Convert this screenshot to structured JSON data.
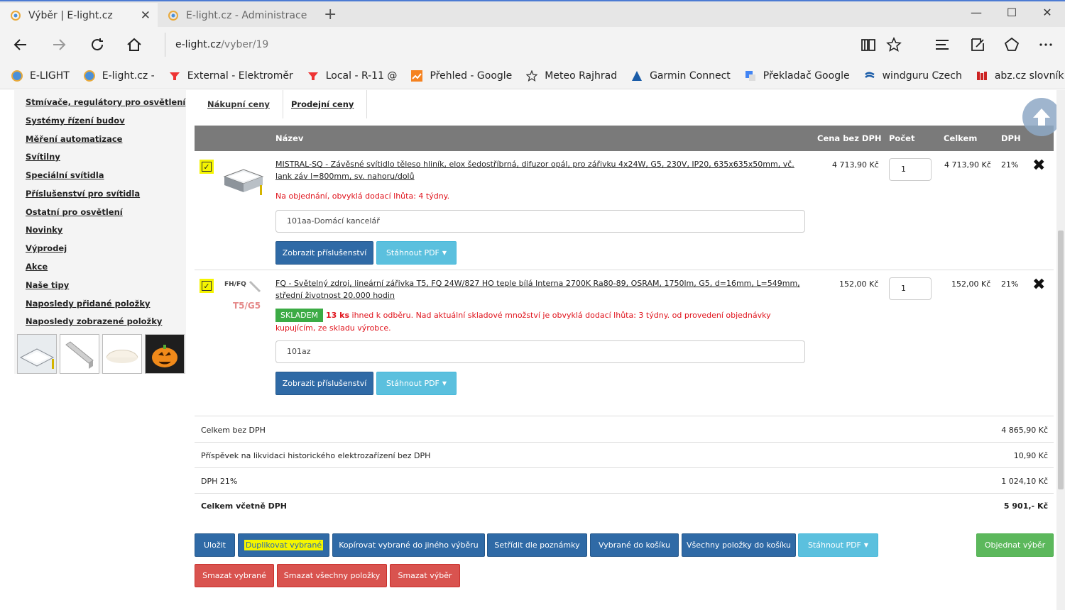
{
  "browser": {
    "tabs": [
      {
        "title": "Výběr | E-light.cz",
        "active": true
      },
      {
        "title": "E-light.cz - Administrace",
        "active": false
      }
    ],
    "url_host": "e-light.cz",
    "url_path": "/vyber/19",
    "favorites": [
      {
        "label": "E-LIGHT",
        "icon": "e-light-icon"
      },
      {
        "label": "E-light.cz -",
        "icon": "e-light-icon"
      },
      {
        "label": "External - Elektroměr",
        "icon": "funnel-icon"
      },
      {
        "label": "Local - R-11 @",
        "icon": "funnel-icon"
      },
      {
        "label": "Přehled - Google",
        "icon": "chart-icon"
      },
      {
        "label": "Meteo Rajhrad",
        "icon": "star-icon"
      },
      {
        "label": "Garmin Connect",
        "icon": "garmin-icon"
      },
      {
        "label": "Překladač Google",
        "icon": "translate-icon"
      },
      {
        "label": "windguru Czech",
        "icon": "windguru-icon"
      },
      {
        "label": "abz.cz slovník cizích",
        "icon": "abz-icon"
      }
    ]
  },
  "sidebar": {
    "categories": [
      "Stmívače, regulátory pro osvětlení",
      "Systémy řízení budov",
      "Měření automatizace",
      "Svítilny",
      "Speciální svítidla",
      "Příslušenství pro svítidla",
      "Ostatní pro osvětlení",
      "Novinky",
      "Výprodej",
      "Akce",
      "Naše tipy",
      "Naposledy přidané položky",
      "Naposledy zobrazené položky"
    ]
  },
  "price_tabs": [
    "Nákupní ceny",
    "Prodejní ceny"
  ],
  "table": {
    "headers": {
      "name": "Název",
      "price": "Cena bez DPH",
      "qty": "Počet",
      "total": "Celkem",
      "vat": "DPH"
    }
  },
  "items": [
    {
      "name": "MISTRAL-SQ - Závěsné svítidlo těleso hliník, elox šedostříbrná, difuzor opál, pro zářivku 4x24W, G5, 230V, IP20, 635x635x50mm, vč. lank záv l=800mm, sv. nahoru/dolů",
      "availability": "Na objednání, obvyklá dodací lhůta: 4 týdny.",
      "price": "4 713,90 Kč",
      "qty": "1",
      "total": "4 713,90 Kč",
      "vat": "21%",
      "note": "101aa-Domácí kancelář"
    },
    {
      "name": "FQ - Světelný zdroj, lineární zářivka T5, FQ 24W/827 HO teple bílá Interna 2700K Ra80-89, OSRAM, 1750lm, G5, d=16mm, L=549mm, střední životnost 20.000 hodin",
      "stock_badge": "SKLADEM",
      "stock_count": "13 ks",
      "availability": "ihned k odběru. Nad aktuální skladové množství je obvyklá dodací lhůta: 3 týdny. od provedení objednávky kupujícím, ze skladu výrobce.",
      "image_text_top": "FH/FQ",
      "image_text_bottom": "T5/G5",
      "price": "152,00 Kč",
      "qty": "1",
      "total": "152,00 Kč",
      "vat": "21%",
      "note": "101az"
    }
  ],
  "item_buttons": {
    "accessories": "Zobrazit příslušenství",
    "pdf": "Stáhnout PDF"
  },
  "summary": [
    {
      "label": "Celkem bez DPH",
      "value": "4 865,90 Kč"
    },
    {
      "label": "Příspěvek na likvidaci historického elektrozařízení bez DPH",
      "value": "10,90 Kč"
    },
    {
      "label": "DPH 21%",
      "value": "1 024,10 Kč"
    },
    {
      "label": "Celkem včetně DPH",
      "value": "5 901,- Kč"
    }
  ],
  "actions": {
    "save": "Uložit",
    "duplicate": "Duplikovat vybrané",
    "copy": "Kopírovat vybrané do jiného výběru",
    "sort": "Setřídit dle poznámky",
    "selected_to_cart": "Vybrané do košíku",
    "all_to_cart": "Všechny položky do košíku",
    "pdf": "Stáhnout PDF",
    "order": "Objednat výběr",
    "delete_selected": "Smazat vybrané",
    "delete_all": "Smazat všechny položky",
    "delete_selection": "Smazat výběr"
  },
  "colors": {
    "primary": "#2f6aa6",
    "info": "#5bc0de",
    "danger": "#d9534f",
    "success": "#5cb85c",
    "stock_badge": "#3cab45",
    "highlight": "#f5f500",
    "availability_text": "#e0121b",
    "table_header": "#7a7a7a"
  }
}
